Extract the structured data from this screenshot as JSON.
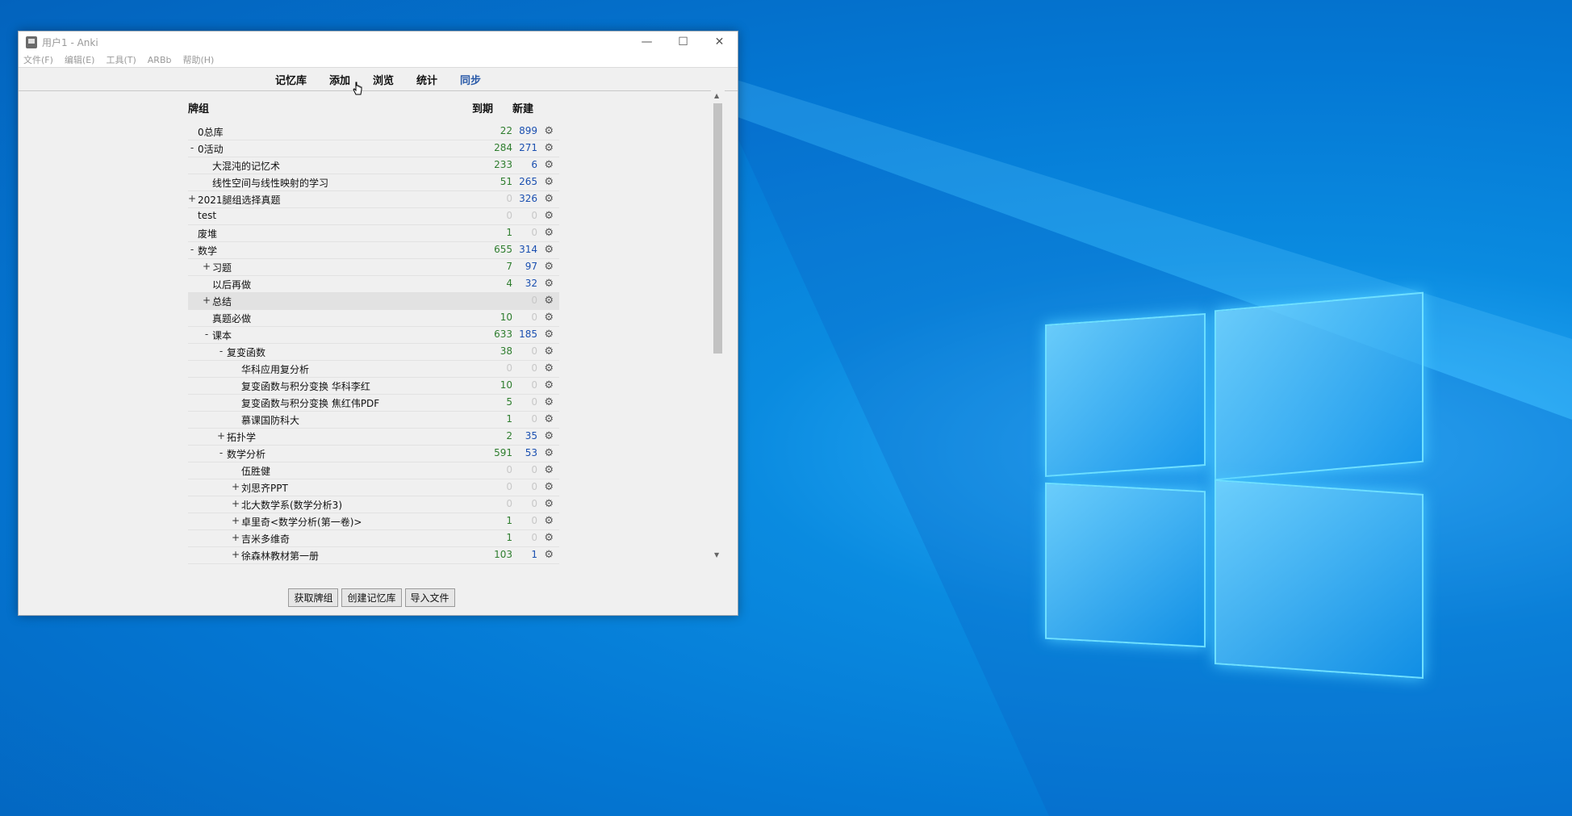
{
  "window": {
    "title": "用户1 - Anki",
    "controls": {
      "minimize": "—",
      "maximize": "☐",
      "close": "✕"
    }
  },
  "menu": [
    "文件(F)",
    "编辑(E)",
    "工具(T)",
    "ARBb",
    "帮助(H)"
  ],
  "toolbar": [
    "记忆库",
    "添加",
    "浏览",
    "统计",
    "同步"
  ],
  "table": {
    "col_deck": "牌组",
    "col_due": "到期",
    "col_new": "新建",
    "rows": [
      {
        "exp": "",
        "name": "0总库",
        "due": "22",
        "new": "899",
        "level": 0
      },
      {
        "exp": "-",
        "name": "0活动",
        "due": "284",
        "new": "271",
        "level": 0
      },
      {
        "exp": "",
        "name": "大混沌的记忆术",
        "due": "233",
        "new": "6",
        "level": 1
      },
      {
        "exp": "",
        "name": "线性空间与线性映射的学习",
        "due": "51",
        "new": "265",
        "level": 1
      },
      {
        "exp": "+",
        "name": "2021腿组选择真题",
        "due": "0",
        "new": "326",
        "level": 0
      },
      {
        "exp": "",
        "name": "test",
        "due": "0",
        "new": "0",
        "level": 0
      },
      {
        "exp": "",
        "name": "废堆",
        "due": "1",
        "new": "0",
        "level": 0
      },
      {
        "exp": "-",
        "name": "数学",
        "due": "655",
        "new": "314",
        "level": 0
      },
      {
        "exp": "+",
        "name": "习题",
        "due": "7",
        "new": "97",
        "level": 1
      },
      {
        "exp": "",
        "name": "以后再做",
        "due": "4",
        "new": "32",
        "level": 1
      },
      {
        "exp": "+",
        "name": "总结",
        "due": "",
        "new": "0",
        "level": 1,
        "highlight": true
      },
      {
        "exp": "",
        "name": "真题必做",
        "due": "10",
        "new": "0",
        "level": 1
      },
      {
        "exp": "-",
        "name": "课本",
        "due": "633",
        "new": "185",
        "level": 1
      },
      {
        "exp": "-",
        "name": "复变函数",
        "due": "38",
        "new": "0",
        "level": 2
      },
      {
        "exp": "",
        "name": "华科应用复分析",
        "due": "0",
        "new": "0",
        "level": 3
      },
      {
        "exp": "",
        "name": "复变函数与积分变换 华科李红",
        "due": "10",
        "new": "0",
        "level": 3
      },
      {
        "exp": "",
        "name": "复变函数与积分变换 焦红伟PDF",
        "due": "5",
        "new": "0",
        "level": 3
      },
      {
        "exp": "",
        "name": "慕课国防科大",
        "due": "1",
        "new": "0",
        "level": 3
      },
      {
        "exp": "+",
        "name": "拓扑学",
        "due": "2",
        "new": "35",
        "level": 2
      },
      {
        "exp": "-",
        "name": "数学分析",
        "due": "591",
        "new": "53",
        "level": 2
      },
      {
        "exp": "",
        "name": "伍胜健",
        "due": "0",
        "new": "0",
        "level": 3
      },
      {
        "exp": "+",
        "name": "刘思齐PPT",
        "due": "0",
        "new": "0",
        "level": 3
      },
      {
        "exp": "+",
        "name": "北大数学系(数学分析3)",
        "due": "0",
        "new": "0",
        "level": 3
      },
      {
        "exp": "+",
        "name": "卓里奇<数学分析(第一卷)>",
        "due": "1",
        "new": "0",
        "level": 3
      },
      {
        "exp": "+",
        "name": "吉米多维奇",
        "due": "1",
        "new": "0",
        "level": 3
      },
      {
        "exp": "+",
        "name": "徐森林教材第一册",
        "due": "103",
        "new": "1",
        "level": 3
      }
    ]
  },
  "buttons": [
    "获取牌组",
    "创建记忆库",
    "导入文件"
  ]
}
